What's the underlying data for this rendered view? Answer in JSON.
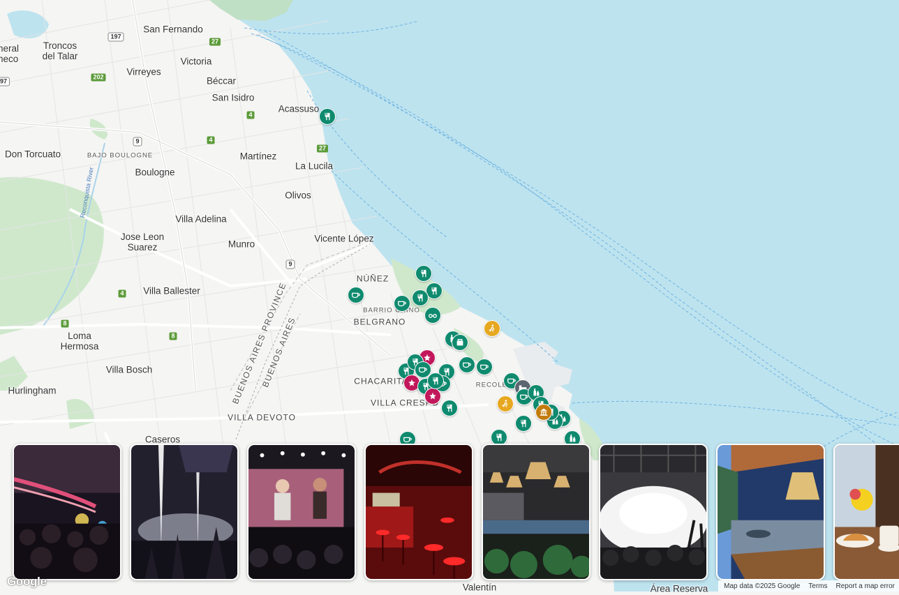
{
  "map": {
    "places": [
      {
        "label": "San Fernando",
        "cls": ""
      },
      {
        "label": "Victoria",
        "cls": ""
      },
      {
        "label": "Virreyes",
        "cls": ""
      },
      {
        "label": "Béccar",
        "cls": ""
      },
      {
        "label": "San Isidro",
        "cls": ""
      },
      {
        "label": "Acassuso",
        "cls": ""
      },
      {
        "label": "Troncos\ndel Talar",
        "cls": ""
      },
      {
        "label": "neral\nneco",
        "cls": ""
      },
      {
        "label": "Don Torcuato",
        "cls": ""
      },
      {
        "label": "BAJO BOULOGNE",
        "cls": "small"
      },
      {
        "label": "Boulogne",
        "cls": ""
      },
      {
        "label": "Martínez",
        "cls": ""
      },
      {
        "label": "La Lucila",
        "cls": ""
      },
      {
        "label": "Olivos",
        "cls": ""
      },
      {
        "label": "Villa Adelina",
        "cls": ""
      },
      {
        "label": "Jose Leon\nSuarez",
        "cls": ""
      },
      {
        "label": "Munro",
        "cls": ""
      },
      {
        "label": "Vicente López",
        "cls": ""
      },
      {
        "label": "NÚÑEZ",
        "cls": "district"
      },
      {
        "label": "BARRIO CHINO",
        "cls": "small"
      },
      {
        "label": "BELGRANO",
        "cls": "district"
      },
      {
        "label": "Villa Ballester",
        "cls": ""
      },
      {
        "label": "Loma\nHermosa",
        "cls": ""
      },
      {
        "label": "Villa Bosch",
        "cls": ""
      },
      {
        "label": "Hurlingham",
        "cls": ""
      },
      {
        "label": "CHACARITA",
        "cls": "district"
      },
      {
        "label": "VILLA CRESPO",
        "cls": "district"
      },
      {
        "label": "VILLA DEVOTO",
        "cls": "district"
      },
      {
        "label": "RECOLETA",
        "cls": "small"
      },
      {
        "label": "Caseros",
        "cls": ""
      },
      {
        "label": "BUENOS AIRES PROVINCE",
        "cls": "rot"
      },
      {
        "label": "BUENOS AIRES",
        "cls": "rot"
      },
      {
        "label": "Reconquista River",
        "cls": "river"
      },
      {
        "label": "Valentín",
        "cls": ""
      },
      {
        "label": "Área Reserva",
        "cls": ""
      }
    ],
    "routes": [
      "197",
      "27",
      "202",
      "97",
      "9",
      "4",
      "4",
      "27",
      "9",
      "4",
      "8",
      "8"
    ],
    "pins": [
      {
        "type": "restaurant",
        "color": "#0f8a6e"
      },
      {
        "type": "restaurant",
        "color": "#0f8a6e"
      },
      {
        "type": "restaurant",
        "color": "#0f8a6e"
      },
      {
        "type": "restaurant",
        "color": "#0f8a6e"
      },
      {
        "type": "cafe",
        "color": "#0f8a6e"
      },
      {
        "type": "cafe",
        "color": "#0f8a6e"
      },
      {
        "type": "viewpoint",
        "color": "#0f8a6e"
      },
      {
        "type": "bar",
        "color": "#0f8a6e"
      },
      {
        "type": "shop",
        "color": "#0f8a6e"
      },
      {
        "type": "activity",
        "color": "#e6a820"
      },
      {
        "type": "cafe",
        "color": "#0f8a6e"
      },
      {
        "type": "cafe",
        "color": "#0f8a6e"
      },
      {
        "type": "restaurant",
        "color": "#0f8a6e"
      },
      {
        "type": "nightlife",
        "color": "#c2185b"
      },
      {
        "type": "restaurant",
        "color": "#0f8a6e"
      },
      {
        "type": "cafe",
        "color": "#0f8a6e"
      },
      {
        "type": "restaurant",
        "color": "#0f8a6e"
      },
      {
        "type": "nightlife",
        "color": "#c2185b"
      },
      {
        "type": "restaurant",
        "color": "#0f8a6e"
      },
      {
        "type": "cafe",
        "color": "#0f8a6e"
      },
      {
        "type": "nightlife",
        "color": "#c2185b"
      },
      {
        "type": "restaurant",
        "color": "#0f8a6e"
      },
      {
        "type": "restaurant",
        "color": "#0f8a6e"
      },
      {
        "type": "cafe",
        "color": "#0f8a6e"
      },
      {
        "type": "hotel",
        "color": "#5b6670"
      },
      {
        "type": "cafe",
        "color": "#0f8a6e"
      },
      {
        "type": "bar",
        "color": "#0f8a6e"
      },
      {
        "type": "activity",
        "color": "#e6a820"
      },
      {
        "type": "restaurant",
        "color": "#0f8a6e"
      },
      {
        "type": "bar",
        "color": "#0f8a6e"
      },
      {
        "type": "bar",
        "color": "#0f8a6e"
      },
      {
        "type": "restaurant",
        "color": "#0f8a6e"
      },
      {
        "type": "museum",
        "color": "#c27c0e"
      },
      {
        "type": "bar",
        "color": "#0f8a6e"
      },
      {
        "type": "restaurant",
        "color": "#0f8a6e"
      },
      {
        "type": "cafe",
        "color": "#0f8a6e"
      },
      {
        "type": "restaurant",
        "color": "#0f8a6e"
      }
    ]
  },
  "photos": [
    {
      "theme": "club crowd with pink lights"
    },
    {
      "theme": "concert with light beams"
    },
    {
      "theme": "stage performers on screen"
    },
    {
      "theme": "red bar interior"
    },
    {
      "theme": "restaurant with wicker lamps"
    },
    {
      "theme": "concert fog crowd"
    },
    {
      "theme": "blue bar with hanging lamp"
    },
    {
      "theme": "cafe croissant and coffee"
    }
  ],
  "logo": "Google",
  "attribution": {
    "map_data": "Map data ©2025 Google",
    "terms": "Terms",
    "report": "Report a map error"
  }
}
